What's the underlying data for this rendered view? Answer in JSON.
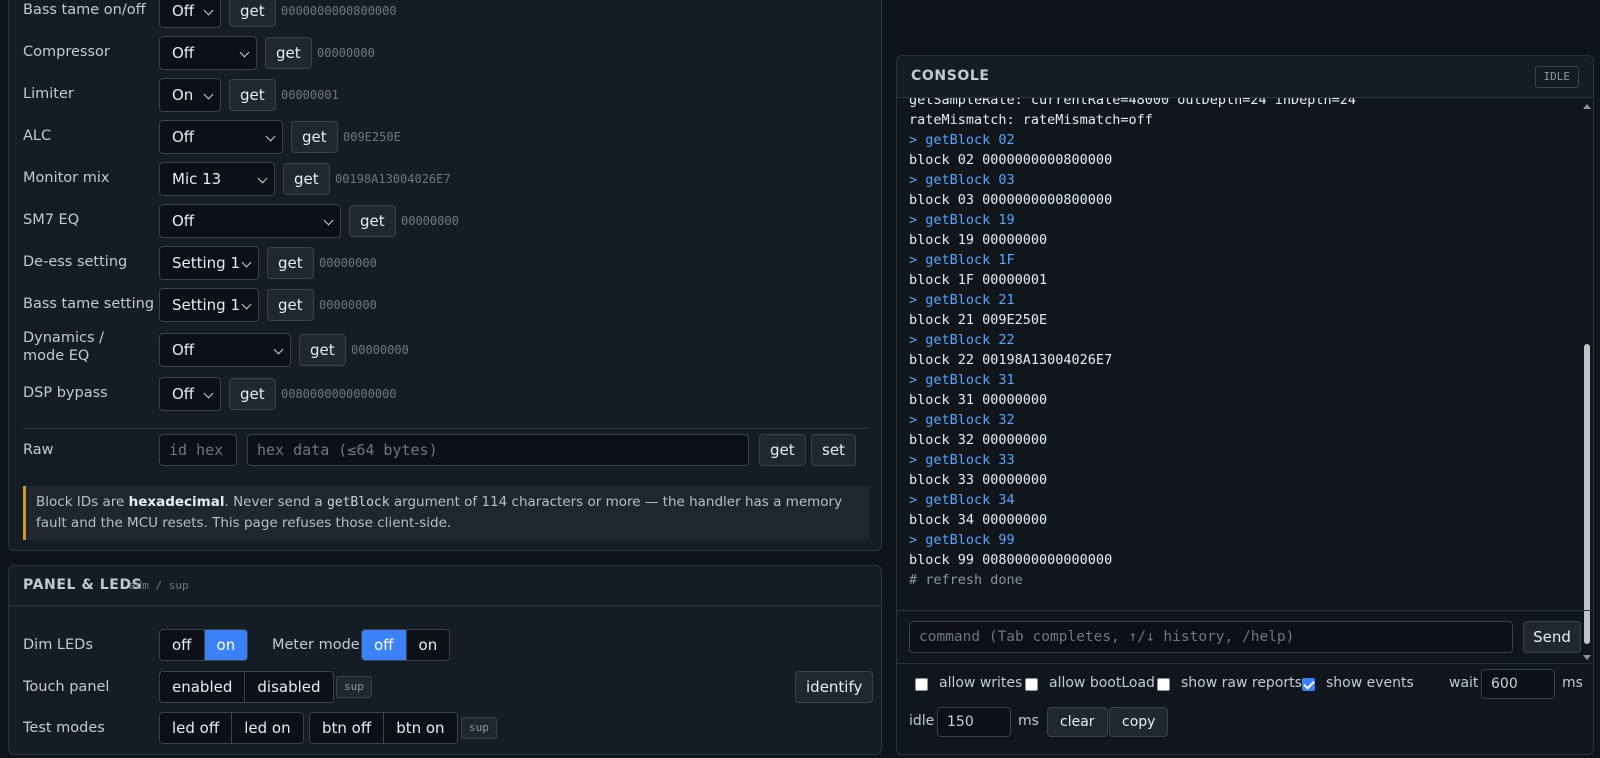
{
  "settings": {
    "rows": [
      {
        "label": "Bass tame on/off",
        "value": "Off",
        "get": "get",
        "hex": "0000000000800000"
      },
      {
        "label": "Compressor",
        "value": "Off",
        "get": "get",
        "hex": "00000000"
      },
      {
        "label": "Limiter",
        "value": "On",
        "get": "get",
        "hex": "00000001"
      },
      {
        "label": "ALC",
        "value": "Off",
        "get": "get",
        "hex": "009E250E"
      },
      {
        "label": "Monitor mix",
        "value": "Mic 13",
        "get": "get",
        "hex": "00198A13004026E7"
      },
      {
        "label": "SM7 EQ",
        "value": "Off",
        "get": "get",
        "hex": "00000000"
      },
      {
        "label": "De-ess setting",
        "value": "Setting 1",
        "get": "get",
        "hex": "00000000"
      },
      {
        "label": "Bass tame setting",
        "value": "Setting 1",
        "get": "get",
        "hex": "00000000"
      },
      {
        "label": "Dynamics / mode EQ",
        "value": "Off",
        "get": "get",
        "hex": "00000000"
      },
      {
        "label": "DSP bypass",
        "value": "Off",
        "get": "get",
        "hex": "0080000000000000"
      }
    ],
    "raw": {
      "label": "Raw",
      "id_placeholder": "id hex",
      "data_placeholder": "hex data (≤64 bytes)",
      "get": "get",
      "set": "set"
    },
    "note": {
      "p1": "Block IDs are ",
      "b1": "hexadecimal",
      "p2": ". Never send a ",
      "code": "getBlock",
      "p3": " argument of 114 characters or more — the handler has a memory fault and the MCU resets. This page refuses those client-side."
    }
  },
  "panel_leds": {
    "title": "PANEL & LEDS",
    "subtitle": "adm / sup",
    "dim_leds": {
      "label": "Dim LEDs",
      "off": "off",
      "on": "on",
      "selected": "on"
    },
    "meter_mode": {
      "label": "Meter mode",
      "off": "off",
      "on": "on",
      "selected": "off"
    },
    "touch_panel": {
      "label": "Touch panel",
      "enabled": "enabled",
      "disabled": "disabled",
      "tag": "sup"
    },
    "identify": "identify",
    "test_modes": {
      "label": "Test modes",
      "led_off": "led off",
      "led_on": "led on",
      "btn_off": "btn off",
      "btn_on": "btn on",
      "tag": "sup"
    }
  },
  "console": {
    "title": "CONSOLE",
    "status": "IDLE",
    "lines": [
      {
        "kind": "out",
        "text": "getSampleRate: currentRate=48000 outDepth=24 inDepth=24"
      },
      {
        "kind": "out",
        "text": "rateMismatch: rateMismatch=off"
      },
      {
        "kind": "cmd",
        "text": "> getBlock 02"
      },
      {
        "kind": "out",
        "text": "block 02 0000000000800000"
      },
      {
        "kind": "cmd",
        "text": "> getBlock 03"
      },
      {
        "kind": "out",
        "text": "block 03 0000000000800000"
      },
      {
        "kind": "cmd",
        "text": "> getBlock 19"
      },
      {
        "kind": "out",
        "text": "block 19 00000000"
      },
      {
        "kind": "cmd",
        "text": "> getBlock 1F"
      },
      {
        "kind": "out",
        "text": "block 1F 00000001"
      },
      {
        "kind": "cmd",
        "text": "> getBlock 21"
      },
      {
        "kind": "out",
        "text": "block 21 009E250E"
      },
      {
        "kind": "cmd",
        "text": "> getBlock 22"
      },
      {
        "kind": "out",
        "text": "block 22 00198A13004026E7"
      },
      {
        "kind": "cmd",
        "text": "> getBlock 31"
      },
      {
        "kind": "out",
        "text": "block 31 00000000"
      },
      {
        "kind": "cmd",
        "text": "> getBlock 32"
      },
      {
        "kind": "out",
        "text": "block 32 00000000"
      },
      {
        "kind": "cmd",
        "text": "> getBlock 33"
      },
      {
        "kind": "out",
        "text": "block 33 00000000"
      },
      {
        "kind": "cmd",
        "text": "> getBlock 34"
      },
      {
        "kind": "out",
        "text": "block 34 00000000"
      },
      {
        "kind": "cmd",
        "text": "> getBlock 99"
      },
      {
        "kind": "out",
        "text": "block 99 0080000000000000"
      },
      {
        "kind": "cmt",
        "text": "# refresh done"
      }
    ],
    "command_placeholder": "command (Tab completes, ↑/↓ history, /help)",
    "send": "Send",
    "options": {
      "allow_writes": {
        "label": "allow writes",
        "checked": false
      },
      "allow_bootload": {
        "label": "allow bootLoad",
        "checked": false
      },
      "show_raw_reports": {
        "label": "show raw reports",
        "checked": false
      },
      "show_events": {
        "label": "show events",
        "checked": true
      },
      "wait_label": "wait",
      "wait_value": "600",
      "wait_unit": "ms",
      "idle_label": "idle",
      "idle_value": "150",
      "idle_unit": "ms",
      "clear": "clear",
      "copy": "copy"
    }
  },
  "colors": {
    "accent": "#3b82f6",
    "command_text": "#58a6ff",
    "warning_border": "#d29922"
  }
}
